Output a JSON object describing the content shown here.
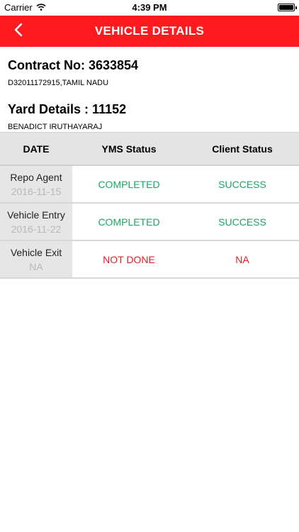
{
  "status_bar": {
    "carrier": "Carrier",
    "time": "4:39 PM"
  },
  "nav": {
    "title": "VEHICLE DETAILS"
  },
  "contract": {
    "title": "Contract No: 3633854",
    "subtitle": "D32011172915,TAMIL NADU"
  },
  "yard": {
    "title": "Yard Details : 11152",
    "subtitle": "BENADICT IRUTHAYARAJ"
  },
  "table": {
    "headers": [
      "DATE",
      "YMS Status",
      "Client Status"
    ],
    "rows": [
      {
        "label": "Repo Agent",
        "date": "2016-11-15",
        "yms": "COMPLETED",
        "client": "SUCCESS"
      },
      {
        "label": "Vehicle Entry",
        "date": "2016-11-22",
        "yms": "COMPLETED",
        "client": "SUCCESS"
      },
      {
        "label": "Vehicle Exit",
        "date": "NA",
        "yms": "NOT DONE",
        "client": "NA"
      }
    ]
  },
  "colors": {
    "nav_bg": "#ff1a1f",
    "success": "#1aa663",
    "failure": "#e02020"
  }
}
